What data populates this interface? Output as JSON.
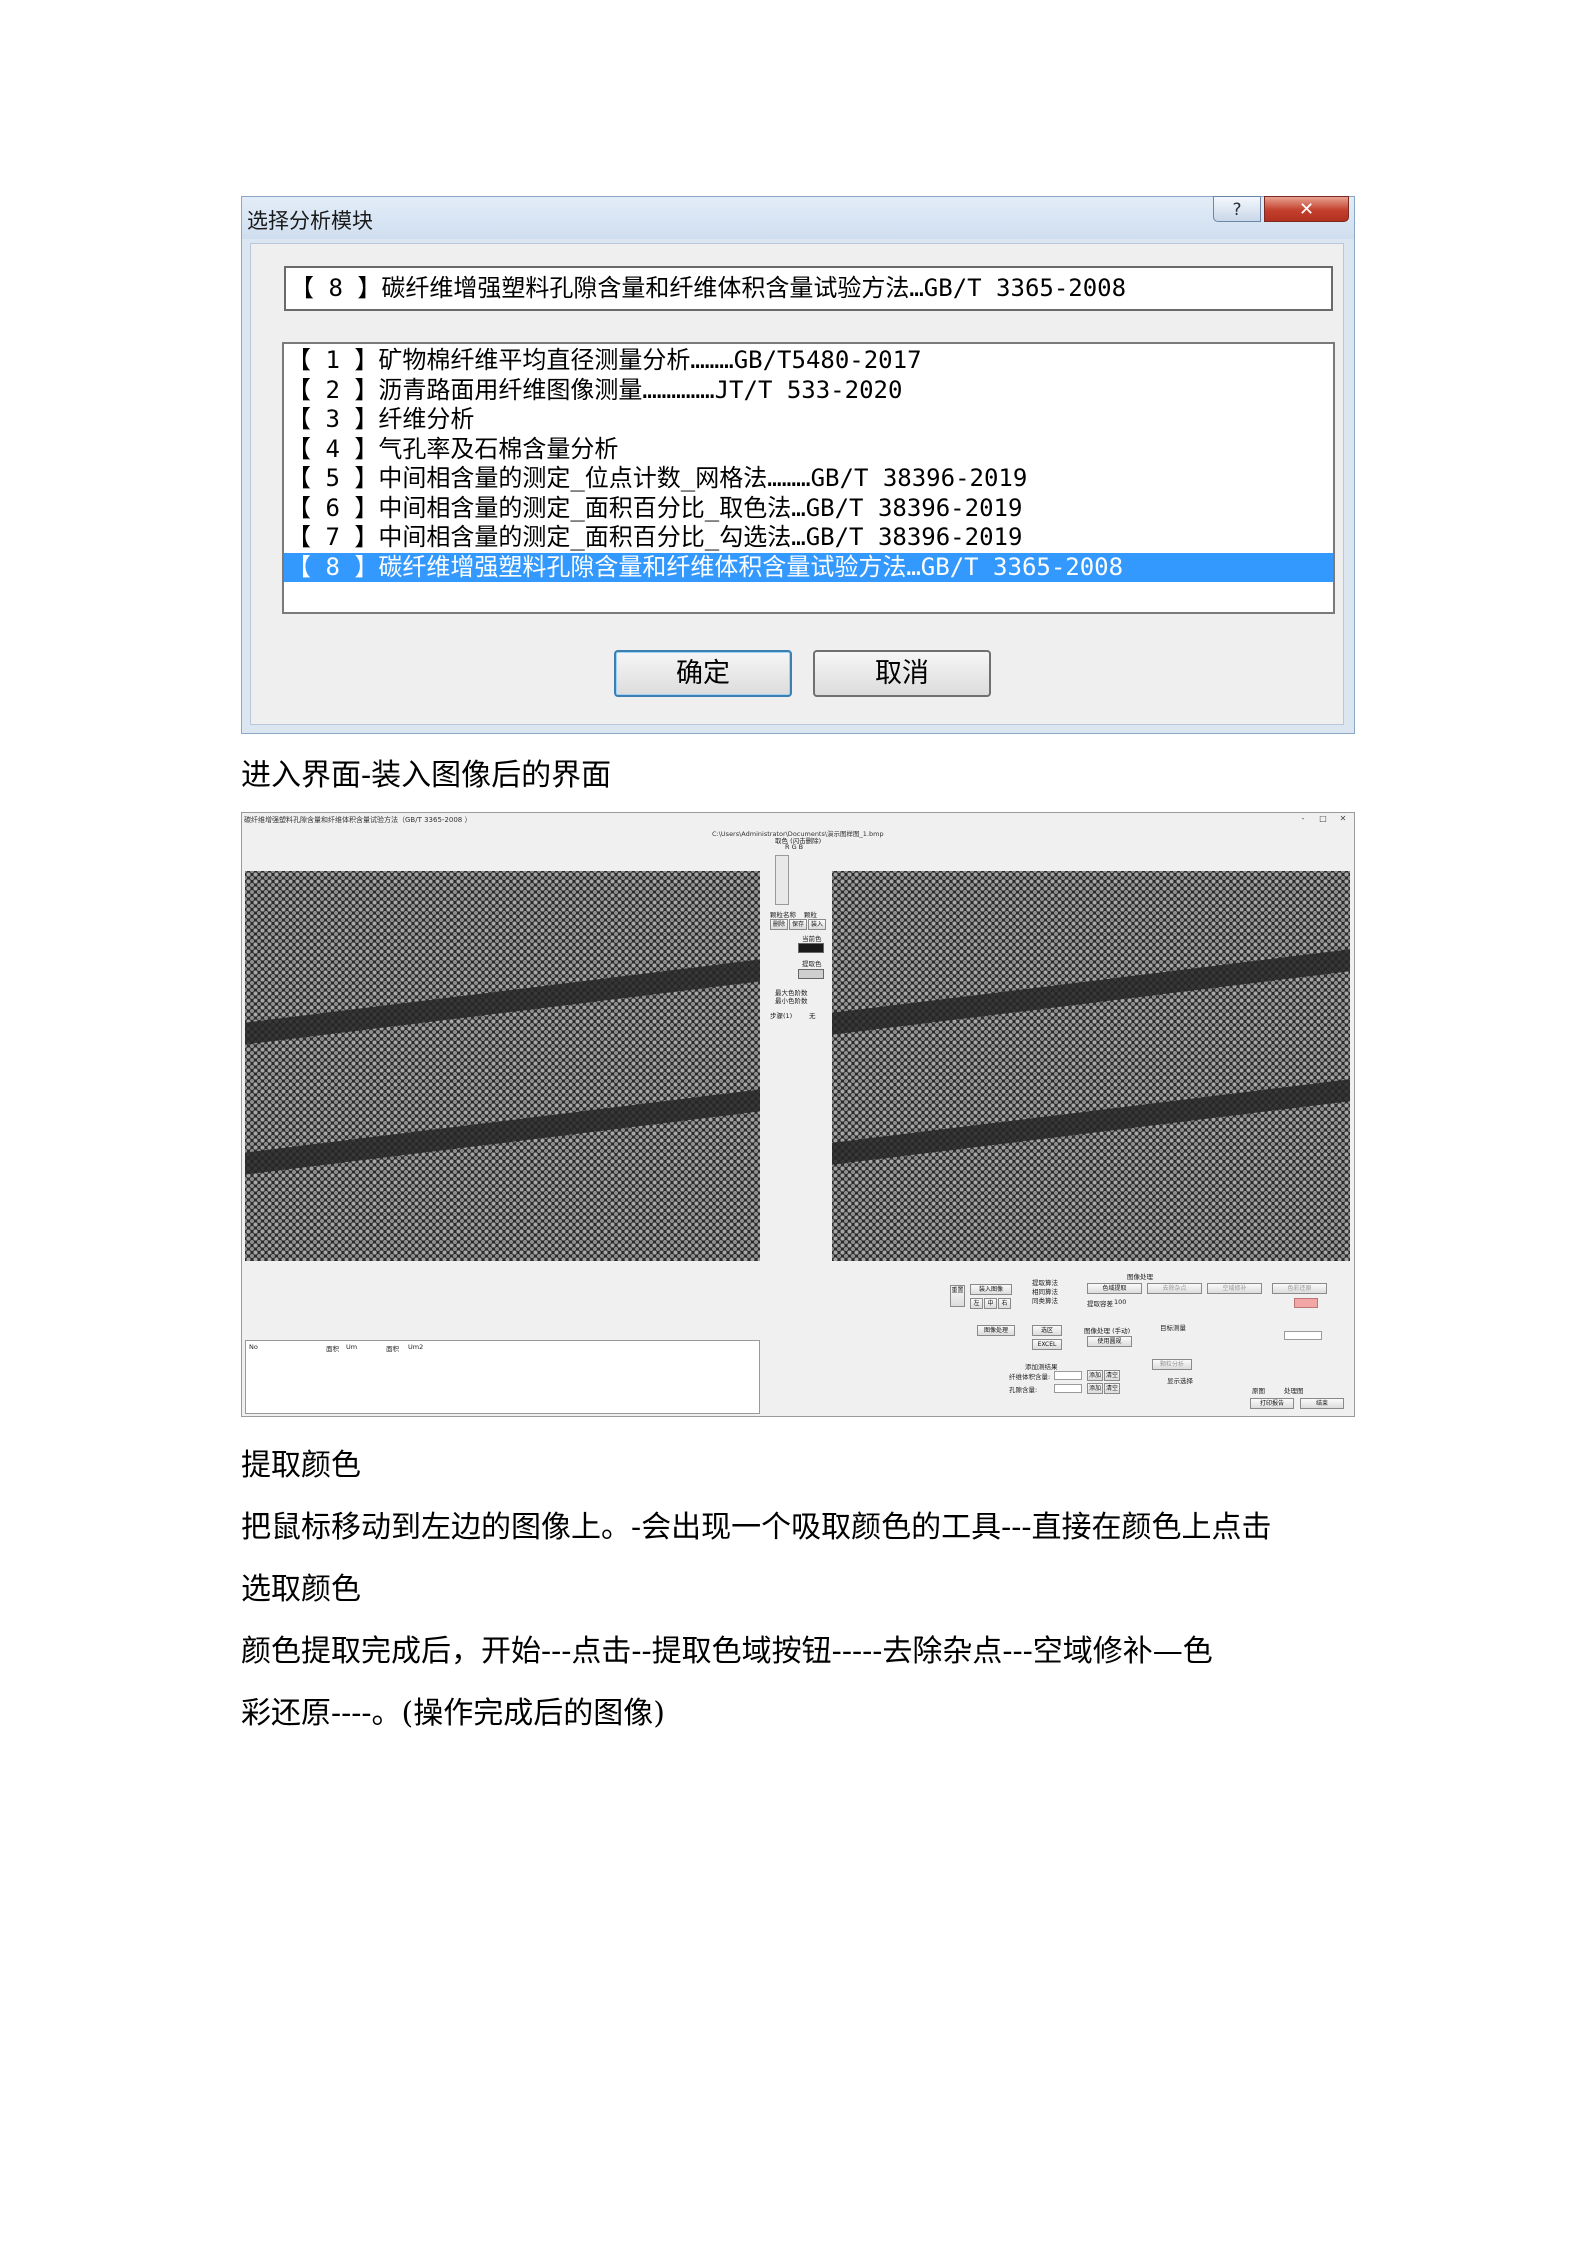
{
  "dialog": {
    "title": "选择分析模块",
    "help_glyph": "?",
    "close_glyph": "✕",
    "selected_value": "【 8 】碳纤维增强塑料孔隙含量和纤维体积含量试验方法…GB/T 3365-2008",
    "items": [
      "【 1 】矿物棉纤维平均直径测量分析………GB/T5480-2017",
      "【 2 】沥青路面用纤维图像测量……………JT/T 533-2020",
      "【 3 】纤维分析",
      "【 4 】气孔率及石棉含量分析",
      "【 5 】中间相含量的测定_位点计数_网格法………GB/T 38396-2019",
      "【 6 】中间相含量的测定_面积百分比_取色法…GB/T 38396-2019",
      "【 7 】中间相含量的测定_面积百分比_勾选法…GB/T 38396-2019",
      "【 8 】碳纤维增强塑料孔隙含量和纤维体积含量试验方法…GB/T 3365-2008"
    ],
    "selected_index": 7,
    "ok_label": "确定",
    "cancel_label": "取消"
  },
  "paragraphs": {
    "p1": "进入界面-装入图像后的界面",
    "p2": "提取颜色",
    "p3": "把鼠标移动到左边的图像上。-会出现一个吸取颜色的工具---直接在颜色上点击",
    "p4": "选取颜色",
    "p5": "颜色提取完成后，开始---点击--提取色域按钮-----去除杂点---空域修补—色",
    "p6": "彩还原----。(操作完成后的图像)"
  },
  "app": {
    "title": "碳纤维增强塑料孔隙含量和纤维体积含量试验方法（GB/T 3365-2008 ）",
    "path": "C:\\Users\\Administrator\\Documents\\演示图样图_1.bmp",
    "window_controls": [
      "-",
      "□",
      "✕"
    ],
    "mid": {
      "color_label": "取色 (闪击删除)",
      "rgb_label": "R  G  B",
      "particle_name": "颗粒名称",
      "particle": "颗粒",
      "delete": "删除",
      "save": "保存",
      "load": "装入",
      "current_color": "当前色",
      "extract_color": "提取色",
      "max_threshold": "最大色阶数",
      "min_threshold": "最小色阶数",
      "step": "步骤(1)",
      "none": "无"
    },
    "controls": {
      "load_image": "装入图像",
      "extract_algo": "提取算法",
      "algo1": "相同算法",
      "algo2": "同类算法",
      "extract_domain": "色域提取",
      "remove_noise": "去除杂点",
      "fill": "空域修补",
      "restore": "色彩还原",
      "image_proc": "图像处理",
      "image_proc_manual": "图像处理 (手动)",
      "target_measure": "目标测量",
      "fiber_analysis": "颗粒分析",
      "draw": "选区",
      "excel": "EXCEL",
      "use_circle": "使用圆规",
      "add_result": "添加测结果",
      "fiber_volume": "纤维体积含量:",
      "void_content": "孔隙含量:",
      "add": "添加",
      "clear": "清空",
      "display": "显示选择",
      "print_report": "打印报告",
      "exit": "结束",
      "reset": "重置",
      "zoom_left": "左",
      "zoom_mid": "中",
      "zoom_right": "右",
      "area_scale": "提取容差",
      "area_val": "100",
      "opt_orig": "原图",
      "opt_proc": "处理图"
    },
    "table": {
      "col_no": "No",
      "col_area": "面积",
      "col_unit": "Um",
      "col_area2": "面积",
      "col_unit2": "Um2"
    }
  }
}
